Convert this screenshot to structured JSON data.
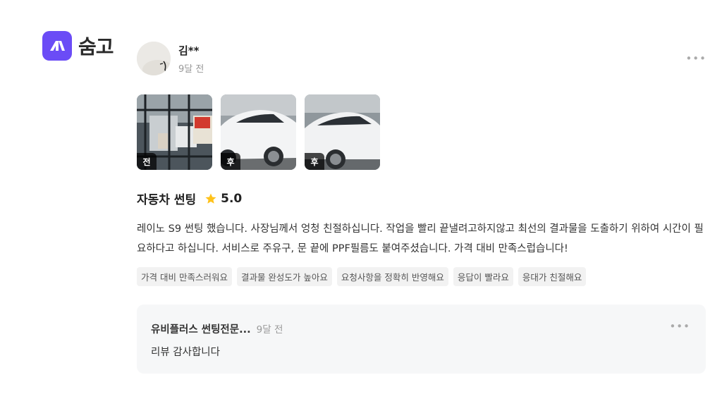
{
  "brand": {
    "logo_text": "숨고",
    "logo_color": "#6b4cf6"
  },
  "review": {
    "user_name": "김**",
    "time": "9달 전",
    "more_label": "•••",
    "photos": [
      {
        "tag": "전"
      },
      {
        "tag": "후"
      },
      {
        "tag": "후"
      }
    ],
    "service": "자동차 썬팅",
    "rating": "5.0",
    "star_color": "#ffc21a",
    "text": "레이노 S9 썬팅 했습니다. 사장님께서 엉청 친절하십니다. 작업을 빨리 끝낼려고하지않고 최선의 결과물을 도출하기 위하여 시간이 필요하다고 하십니다. 서비스로 주유구, 문 끝에 PPF필름도 붙여주셨습니다. 가격 대비 만족스럽습니다!",
    "tags": [
      "가격 대비 만족스러워요",
      "결과물 완성도가 높아요",
      "요청사항을 정확히 반영해요",
      "응답이 빨라요",
      "응대가 친절해요"
    ]
  },
  "reply": {
    "name": "유비플러스 썬팅전문...",
    "time": "9달 전",
    "more_label": "•••",
    "text": "리뷰 감사합니다"
  }
}
